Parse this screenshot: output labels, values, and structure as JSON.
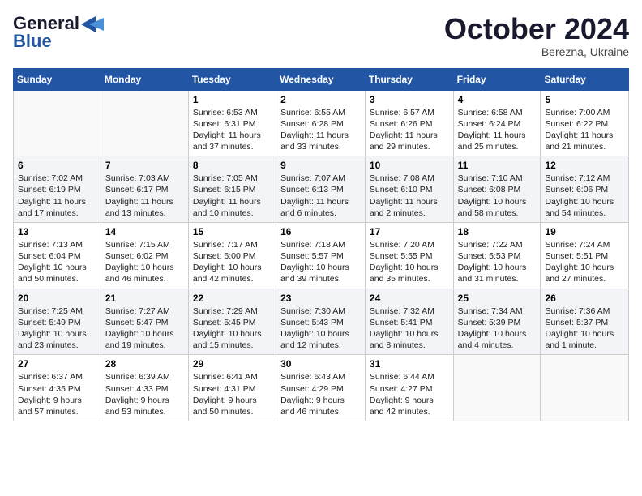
{
  "logo": {
    "line1": "General",
    "line2": "Blue"
  },
  "header": {
    "month": "October 2024",
    "location": "Berezna, Ukraine"
  },
  "weekdays": [
    "Sunday",
    "Monday",
    "Tuesday",
    "Wednesday",
    "Thursday",
    "Friday",
    "Saturday"
  ],
  "weeks": [
    [
      {
        "num": "",
        "info": ""
      },
      {
        "num": "",
        "info": ""
      },
      {
        "num": "1",
        "info": "Sunrise: 6:53 AM\nSunset: 6:31 PM\nDaylight: 11 hours and 37 minutes."
      },
      {
        "num": "2",
        "info": "Sunrise: 6:55 AM\nSunset: 6:28 PM\nDaylight: 11 hours and 33 minutes."
      },
      {
        "num": "3",
        "info": "Sunrise: 6:57 AM\nSunset: 6:26 PM\nDaylight: 11 hours and 29 minutes."
      },
      {
        "num": "4",
        "info": "Sunrise: 6:58 AM\nSunset: 6:24 PM\nDaylight: 11 hours and 25 minutes."
      },
      {
        "num": "5",
        "info": "Sunrise: 7:00 AM\nSunset: 6:22 PM\nDaylight: 11 hours and 21 minutes."
      }
    ],
    [
      {
        "num": "6",
        "info": "Sunrise: 7:02 AM\nSunset: 6:19 PM\nDaylight: 11 hours and 17 minutes."
      },
      {
        "num": "7",
        "info": "Sunrise: 7:03 AM\nSunset: 6:17 PM\nDaylight: 11 hours and 13 minutes."
      },
      {
        "num": "8",
        "info": "Sunrise: 7:05 AM\nSunset: 6:15 PM\nDaylight: 11 hours and 10 minutes."
      },
      {
        "num": "9",
        "info": "Sunrise: 7:07 AM\nSunset: 6:13 PM\nDaylight: 11 hours and 6 minutes."
      },
      {
        "num": "10",
        "info": "Sunrise: 7:08 AM\nSunset: 6:10 PM\nDaylight: 11 hours and 2 minutes."
      },
      {
        "num": "11",
        "info": "Sunrise: 7:10 AM\nSunset: 6:08 PM\nDaylight: 10 hours and 58 minutes."
      },
      {
        "num": "12",
        "info": "Sunrise: 7:12 AM\nSunset: 6:06 PM\nDaylight: 10 hours and 54 minutes."
      }
    ],
    [
      {
        "num": "13",
        "info": "Sunrise: 7:13 AM\nSunset: 6:04 PM\nDaylight: 10 hours and 50 minutes."
      },
      {
        "num": "14",
        "info": "Sunrise: 7:15 AM\nSunset: 6:02 PM\nDaylight: 10 hours and 46 minutes."
      },
      {
        "num": "15",
        "info": "Sunrise: 7:17 AM\nSunset: 6:00 PM\nDaylight: 10 hours and 42 minutes."
      },
      {
        "num": "16",
        "info": "Sunrise: 7:18 AM\nSunset: 5:57 PM\nDaylight: 10 hours and 39 minutes."
      },
      {
        "num": "17",
        "info": "Sunrise: 7:20 AM\nSunset: 5:55 PM\nDaylight: 10 hours and 35 minutes."
      },
      {
        "num": "18",
        "info": "Sunrise: 7:22 AM\nSunset: 5:53 PM\nDaylight: 10 hours and 31 minutes."
      },
      {
        "num": "19",
        "info": "Sunrise: 7:24 AM\nSunset: 5:51 PM\nDaylight: 10 hours and 27 minutes."
      }
    ],
    [
      {
        "num": "20",
        "info": "Sunrise: 7:25 AM\nSunset: 5:49 PM\nDaylight: 10 hours and 23 minutes."
      },
      {
        "num": "21",
        "info": "Sunrise: 7:27 AM\nSunset: 5:47 PM\nDaylight: 10 hours and 19 minutes."
      },
      {
        "num": "22",
        "info": "Sunrise: 7:29 AM\nSunset: 5:45 PM\nDaylight: 10 hours and 15 minutes."
      },
      {
        "num": "23",
        "info": "Sunrise: 7:30 AM\nSunset: 5:43 PM\nDaylight: 10 hours and 12 minutes."
      },
      {
        "num": "24",
        "info": "Sunrise: 7:32 AM\nSunset: 5:41 PM\nDaylight: 10 hours and 8 minutes."
      },
      {
        "num": "25",
        "info": "Sunrise: 7:34 AM\nSunset: 5:39 PM\nDaylight: 10 hours and 4 minutes."
      },
      {
        "num": "26",
        "info": "Sunrise: 7:36 AM\nSunset: 5:37 PM\nDaylight: 10 hours and 1 minute."
      }
    ],
    [
      {
        "num": "27",
        "info": "Sunrise: 6:37 AM\nSunset: 4:35 PM\nDaylight: 9 hours and 57 minutes."
      },
      {
        "num": "28",
        "info": "Sunrise: 6:39 AM\nSunset: 4:33 PM\nDaylight: 9 hours and 53 minutes."
      },
      {
        "num": "29",
        "info": "Sunrise: 6:41 AM\nSunset: 4:31 PM\nDaylight: 9 hours and 50 minutes."
      },
      {
        "num": "30",
        "info": "Sunrise: 6:43 AM\nSunset: 4:29 PM\nDaylight: 9 hours and 46 minutes."
      },
      {
        "num": "31",
        "info": "Sunrise: 6:44 AM\nSunset: 4:27 PM\nDaylight: 9 hours and 42 minutes."
      },
      {
        "num": "",
        "info": ""
      },
      {
        "num": "",
        "info": ""
      }
    ]
  ]
}
